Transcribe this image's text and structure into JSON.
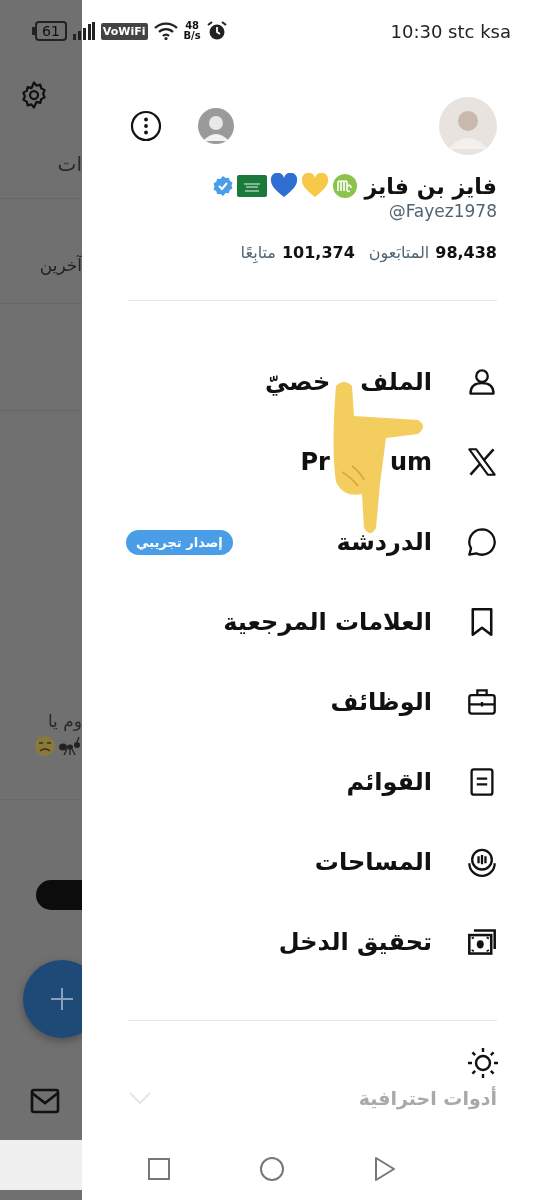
{
  "status_bar": {
    "battery": "61",
    "calling_badge": "VoWiFi",
    "speed_value": "48",
    "speed_unit": "B/s",
    "time_carrier": "10:30 stc ksa"
  },
  "background_feed": {
    "tab_label": "ات",
    "item_text": "آخرين",
    "post_text": "وم يا"
  },
  "drawer": {
    "account": {
      "name": "فايز بن فايز",
      "verified": true,
      "handle": "@Fayez1978",
      "followers_count": "98,438",
      "followers_label": "المتابَعون",
      "following_count": "101,374",
      "following_label": "متابِعًا"
    },
    "menu": [
      {
        "kind": "profile",
        "label_parts": [
          "الملف",
          "خصيّ"
        ]
      },
      {
        "kind": "premium",
        "label_start": "Pr",
        "label_end": "um"
      },
      {
        "kind": "chat",
        "label": "الدردشة",
        "badge": "إصدار تجريبي"
      },
      {
        "kind": "bookmarks",
        "label": "العلامات المرجعية"
      },
      {
        "kind": "jobs",
        "label": "الوظائف"
      },
      {
        "kind": "lists",
        "label": "القوائم"
      },
      {
        "kind": "spaces",
        "label": "المساحات"
      },
      {
        "kind": "monetization",
        "label": "تحقيق الدخل"
      }
    ],
    "professional_tools": {
      "label": "أدوات احترافية",
      "expanded": false
    }
  }
}
